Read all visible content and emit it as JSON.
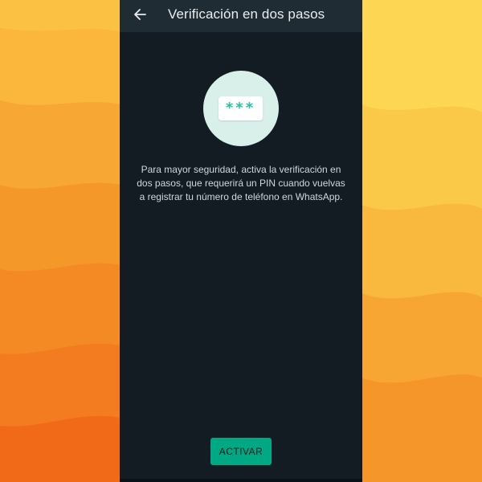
{
  "app_bar": {
    "title": "Verificación en dos pasos",
    "back_icon": "arrow-left-icon"
  },
  "hero": {
    "pin_mask": "***",
    "lock_card_icon": "pin-card-icon"
  },
  "description": "Para mayor seguridad, activa la verificación en dos pasos, que requerirá un PIN cuando vuelvas a registrar tu número de teléfono en WhatsApp.",
  "actions": {
    "activate_label": "ACTIVAR"
  },
  "colors": {
    "accent": "#00a884",
    "screen_background": "#121c22",
    "app_bar_background": "#1f2c33",
    "pin_text": "#24c0a4",
    "hero_circle": "#d9efea",
    "wallpaper_light": "#fdd754",
    "wallpaper_dark": "#f06517"
  }
}
